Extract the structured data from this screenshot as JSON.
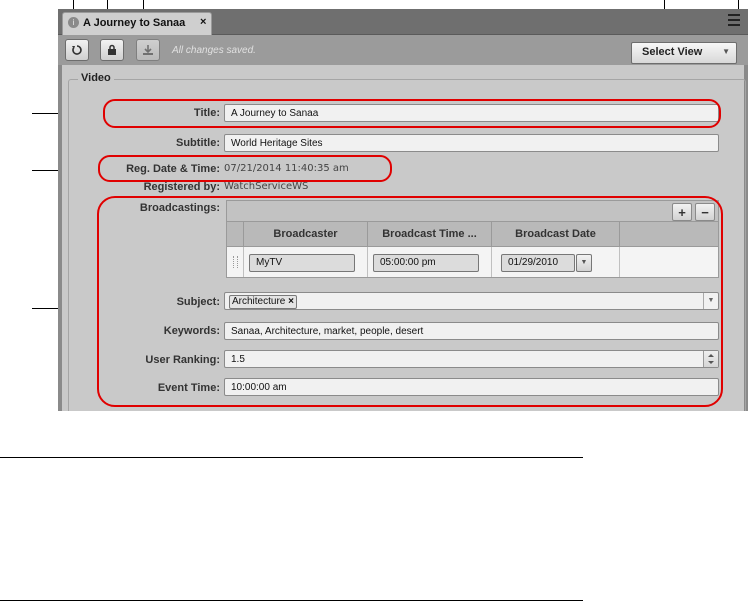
{
  "window": {
    "tab": {
      "title": "A Journey to Sanaa",
      "close": "×"
    },
    "toolbar": {
      "status": "All changes saved.",
      "select_view_label": "Select View"
    }
  },
  "video_group": {
    "label": "Video",
    "fields": {
      "title": {
        "label": "Title:",
        "value": "A Journey to Sanaa"
      },
      "subtitle": {
        "label": "Subtitle:",
        "value": "World Heritage Sites"
      },
      "reg_date": {
        "label": "Reg. Date & Time:",
        "value": "07/21/2014 11:40:35 am"
      },
      "registered_by": {
        "label": "Registered by:",
        "value": "WatchServiceWS"
      },
      "broadcastings": {
        "label": "Broadcastings:"
      },
      "subject": {
        "label": "Subject:",
        "tag": "Architecture"
      },
      "keywords": {
        "label": "Keywords:",
        "value": "Sanaa, Architecture, market, people, desert"
      },
      "user_ranking": {
        "label": "User Ranking:",
        "value": "1.5"
      },
      "event_time": {
        "label": "Event Time:",
        "value": "10:00:00 am"
      }
    },
    "broadcast_table": {
      "add": "+",
      "remove": "−",
      "columns": [
        "Broadcaster",
        "Broadcast Time ...",
        "Broadcast Date"
      ],
      "rows": [
        {
          "broadcaster": "MyTV",
          "time": "05:00:00 pm",
          "date": "01/29/2010"
        }
      ]
    }
  },
  "colors": {
    "highlight": "#e00000"
  }
}
